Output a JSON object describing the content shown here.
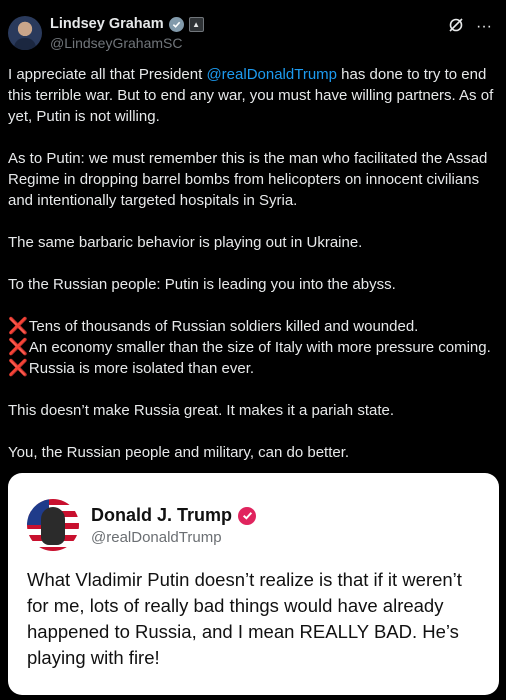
{
  "author": {
    "display_name": "Lindsey Graham",
    "handle": "@LindseyGrahamSC",
    "verified_icon": "verified-badge-icon",
    "affiliate_icon": "government-badge-icon"
  },
  "actions": {
    "grok_icon": "grok-icon",
    "more_icon": "more-options-icon"
  },
  "tweet": {
    "p1_before": "I appreciate all that President ",
    "p1_mention": "@realDonaldTrump",
    "p1_after": " has done to try to end this terrible war. But to end any war, you must have willing partners. As of yet, Putin is not willing.",
    "p2": "As to Putin: we must remember this is the man who facilitated the Assad Regime in dropping barrel bombs from helicopters on innocent civilians and intentionally targeted hospitals in Syria.",
    "p3": "The same barbaric behavior is playing out in Ukraine.",
    "p4": "To the Russian people: Putin is leading you into the abyss.",
    "bullet_mark": "❌",
    "bullets": [
      "Tens of thousands of Russian soldiers killed and wounded.",
      "An economy smaller than the size of Italy with more pressure coming.",
      "Russia is more isolated than ever."
    ],
    "p5": "This doesn’t make Russia great. It makes it a pariah state.",
    "p6": "You, the Russian people and military, can do better."
  },
  "quoted": {
    "display_name": "Donald J. Trump",
    "handle": "@realDonaldTrump",
    "text": "What Vladimir Putin doesn’t realize is that if it weren’t for me, lots of really bad things would have already happened to Russia, and I mean REALLY BAD. He’s playing with fire!"
  },
  "colors": {
    "background": "#000000",
    "text": "#e7e9ea",
    "mention": "#1d9bf0",
    "x_mark": "#e0245e",
    "card_background": "#ffffff",
    "card_verified": "#e0245e"
  }
}
